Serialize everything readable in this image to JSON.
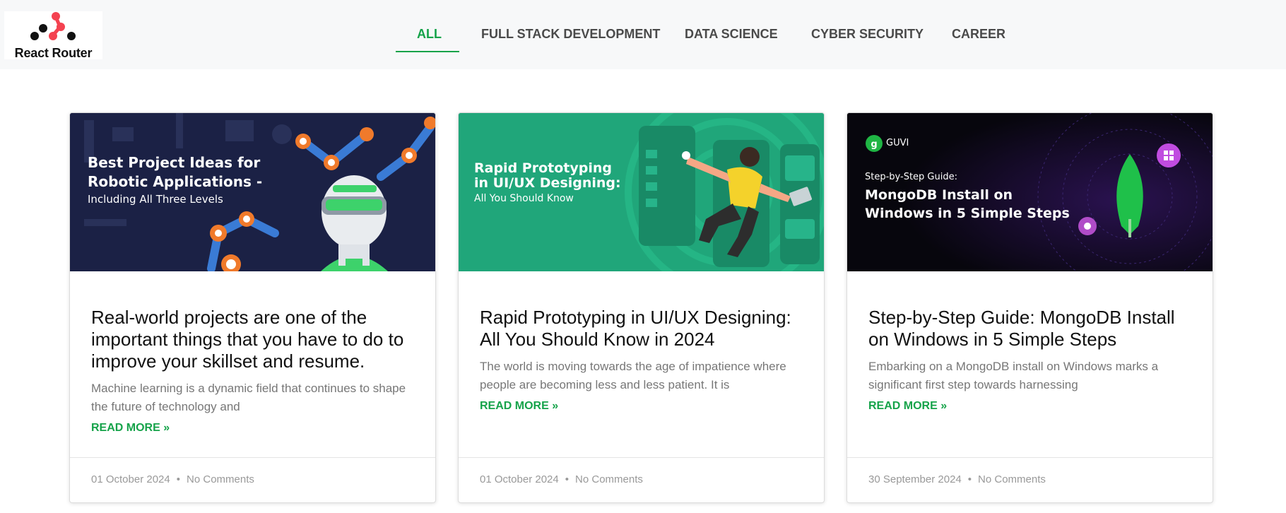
{
  "brand": {
    "name": "React Router"
  },
  "nav": {
    "items": [
      {
        "label": "ALL",
        "active": true
      },
      {
        "label": "FULL STACK DEVELOPMENT",
        "active": false
      },
      {
        "label": "DATA SCIENCE",
        "active": false
      },
      {
        "label": "CYBER SECURITY",
        "active": false
      },
      {
        "label": "CAREER",
        "active": false
      }
    ]
  },
  "colors": {
    "accent": "#16a34a",
    "header_bg": "#f7f8f9"
  },
  "cards": [
    {
      "image": {
        "theme": "robotics-illustration",
        "bg": "#1b2145",
        "lines": [
          "Best Project Ideas for",
          "Robotic Applications -",
          "Including All Three Levels"
        ]
      },
      "title": "Real-world projects are one of the important things that you have to do to improve your skillset and resume.",
      "excerpt": "Machine learning is a dynamic field that continues to shape the future of technology and",
      "read_more": "READ MORE »",
      "date": "01 October 2024",
      "comments": "No Comments"
    },
    {
      "image": {
        "theme": "prototyping-illustration",
        "bg": "#20a67a",
        "lines": [
          "Rapid Prototyping",
          "in UI/UX Designing:",
          "All You Should Know"
        ]
      },
      "title": "Rapid Prototyping in UI/UX Designing: All You Should Know in 2024",
      "excerpt": "The world is moving towards the age of impatience where people are becoming less and less patient. It is",
      "read_more": "READ MORE »",
      "date": "01 October 2024",
      "comments": "No Comments"
    },
    {
      "image": {
        "theme": "mongodb-illustration",
        "bg": "#07060d",
        "badge": "GUVI",
        "lines": [
          "Step-by-Step Guide:",
          "MongoDB Install on",
          "Windows in 5 Simple Steps"
        ]
      },
      "title": "Step-by-Step Guide: MongoDB Install on Windows in 5 Simple Steps",
      "excerpt": "Embarking on a MongoDB install on Windows marks a significant first step towards harnessing",
      "read_more": "READ MORE »",
      "date": "30 September 2024",
      "comments": "No Comments"
    }
  ]
}
